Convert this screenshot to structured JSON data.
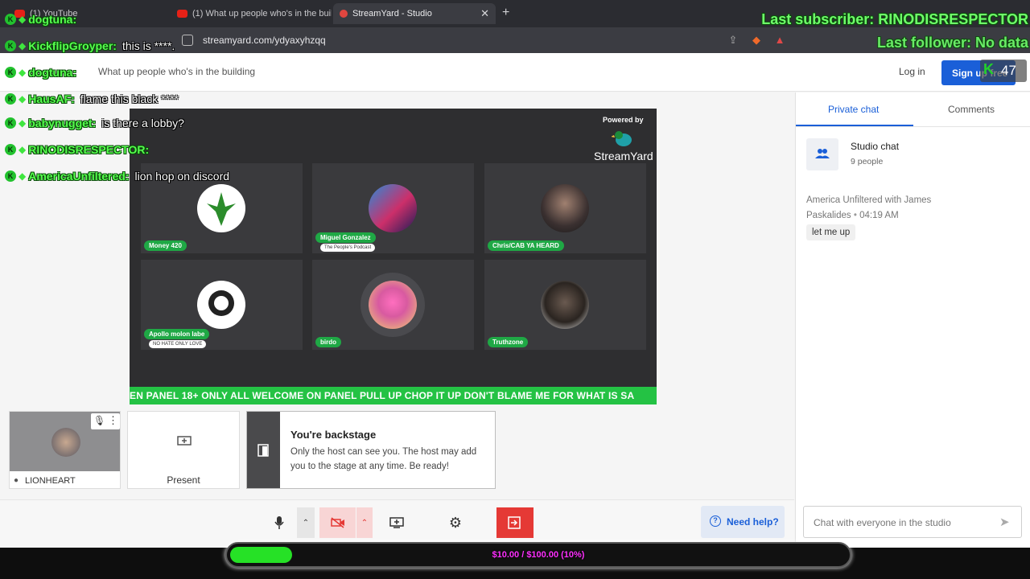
{
  "browser": {
    "tabs": [
      {
        "label": "(1) YouTube",
        "favicon": "youtube-favicon"
      },
      {
        "label": "(1) What up people who's in the buil",
        "favicon": "youtube-favicon"
      },
      {
        "label": "StreamYard - Studio",
        "favicon": "streamyard-favicon"
      }
    ],
    "new_tab_glyph": "+",
    "close_glyph": "✕",
    "url": "streamyard.com/ydyaxyhzqq"
  },
  "header": {
    "title": "What up people who's in the building",
    "login": "Log in",
    "signup": "Sign up free"
  },
  "stage": {
    "powered_by": "Powered by",
    "logo_text": "StreamYard",
    "participants": [
      {
        "name": "Money 420",
        "sub": ""
      },
      {
        "name": "Miguel Gonzalez",
        "sub": "The People's Podcast"
      },
      {
        "name": "Chris/CAB YA HEARD",
        "sub": ""
      },
      {
        "name": "Apollo molon labe",
        "sub": "NO HATE ONLY LOVE"
      },
      {
        "name": "birdo",
        "sub": ""
      },
      {
        "name": "Truthzone",
        "sub": ""
      }
    ],
    "ticker": "EN PANEL 18+ ONLY ALL WELCOME ON PANEL PULL UP CHOP IT UP DON'T BLAME ME FOR WHAT IS SA"
  },
  "preview": {
    "self_name": "LIONHEART",
    "present_label": "Present",
    "backstage_title": "You're backstage",
    "backstage_body": "Only the host can see you. The host may add you to the stage at any time. Be ready!"
  },
  "toolbar": {
    "help_label": "Need help?"
  },
  "chat_panel": {
    "tabs": [
      "Private chat",
      "Comments"
    ],
    "studio_chat_title": "Studio chat",
    "studio_chat_count": "9 people",
    "message_author": "America Unfiltered with James Paskalides",
    "message_time": "04:19 AM",
    "message_text": "let me up",
    "input_placeholder": "Chat with everyone in the studio"
  },
  "overlay": {
    "chat": [
      {
        "user": "dogtuna:",
        "msg": ""
      },
      {
        "user": "KickflipGroyper:",
        "msg": "this is ****."
      },
      {
        "user": "dogtuna:",
        "msg": ""
      },
      {
        "user": "HausAF:",
        "msg": "flame this black ****"
      },
      {
        "user": "babynugget:",
        "msg": "is there a lobby?"
      },
      {
        "user": "RINODISRESPECTOR:",
        "msg": ""
      },
      {
        "user": "AmericaUnfiltered:",
        "msg": "lion hop on discord"
      }
    ],
    "last_subscriber": "Last subscriber: RINODISRESPECTOR",
    "last_follower": "Last follower: No data",
    "viewer_count": "47",
    "goal_text": "$10.00 / $100.00 (10%)",
    "goal_progress": 0.1
  },
  "colors": {
    "accent": "#1a5fd8",
    "tag_green": "#1fa845",
    "ticker_green": "#24c244",
    "stop_red": "#e53935",
    "overlay_green": "#57ff4f",
    "goal_text": "#ff2fff"
  }
}
